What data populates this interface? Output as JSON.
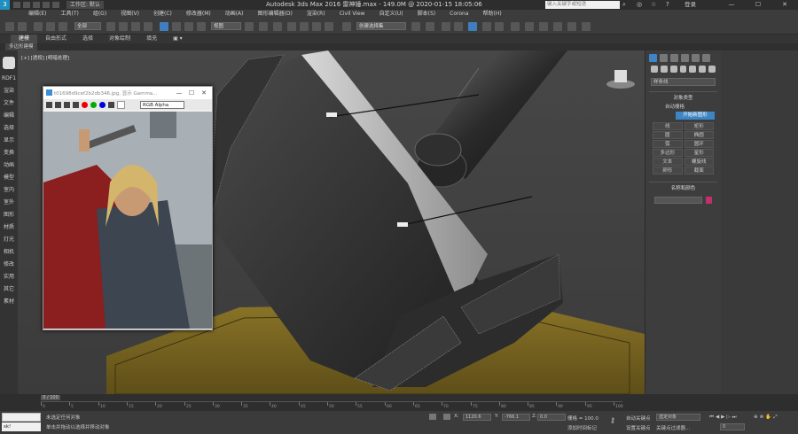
{
  "titlebar": {
    "workspace_label": "工作区: 默认",
    "title": "Autodesk 3ds Max 2016    雷神锤.max - 149.0M @ 2020-01-15 18:05:06",
    "search_placeholder": "键入关键字或短语",
    "user": "登录",
    "minimize": "—",
    "maximize": "☐",
    "close": "✕"
  },
  "menu": [
    "编辑(E)",
    "工具(T)",
    "组(G)",
    "视图(V)",
    "创建(C)",
    "修改器(M)",
    "动画(A)",
    "图形编辑器(D)",
    "渲染(R)",
    "Civil View",
    "自定义(U)",
    "脚本(S)",
    "Corona",
    "帮助(H)"
  ],
  "toolbar": {
    "selection_filter": "全部",
    "reference_coord": "视图",
    "named_selection": "创建选择集"
  },
  "ribbon": {
    "tabs": [
      "建模",
      "自由形式",
      "选择",
      "对象绘制",
      "填充"
    ],
    "active_tab": "建模",
    "sub_label": "多边形建模"
  },
  "leftbar": {
    "top_label": "RDF1",
    "items": [
      "渲染",
      "文件",
      "编辑",
      "选择",
      "显示",
      "变换",
      "动画",
      "模型",
      "室内",
      "室外",
      "图形",
      "材质",
      "灯光",
      "相机",
      "修改",
      "实用",
      "其它",
      "素材"
    ]
  },
  "viewport": {
    "label": "[+] [透视] [明暗处理]"
  },
  "image_window": {
    "title": "t01698d9cef2b2db346.jpg, 显示 Gamma...",
    "channel_dropdown": "RGB Alpha",
    "minimize": "—",
    "maximize": "☐",
    "close": "✕"
  },
  "command_panel": {
    "category_dropdown": "样条线",
    "object_type_header": "对象类型",
    "auto_grid": "自动栅格",
    "start_new_shape": "开始新图形",
    "buttons": [
      "线",
      "矩形",
      "圆",
      "椭圆",
      "弧",
      "圆环",
      "多边形",
      "星形",
      "文本",
      "螺旋线",
      "卵形",
      "截面"
    ],
    "name_color_header": "名称和颜色",
    "object_color": "#c0306a"
  },
  "timeline": {
    "frame_label": "0 / 100",
    "ticks": [
      "0",
      "5",
      "10",
      "15",
      "20",
      "25",
      "30",
      "35",
      "40",
      "45",
      "50",
      "55",
      "60",
      "65",
      "70",
      "75",
      "80",
      "85",
      "90",
      "95",
      "100"
    ]
  },
  "statusbar": {
    "maxscript_text": "sk!",
    "message1": "未选定任何对象",
    "message2": "单击并拖动以选择并移动对象",
    "x_label": "X:",
    "x_value": "1120.6",
    "y_label": "Y:",
    "y_value": "-766.1",
    "z_label": "Z:",
    "z_value": "0.0",
    "grid_label": "栅格 = 100.0",
    "add_time_tag": "添加时间标记",
    "auto_key": "自动关键点",
    "selected_object": "选定对象",
    "set_key": "设置关键点",
    "key_filters": "关键点过滤器...",
    "frame_value": "0"
  }
}
